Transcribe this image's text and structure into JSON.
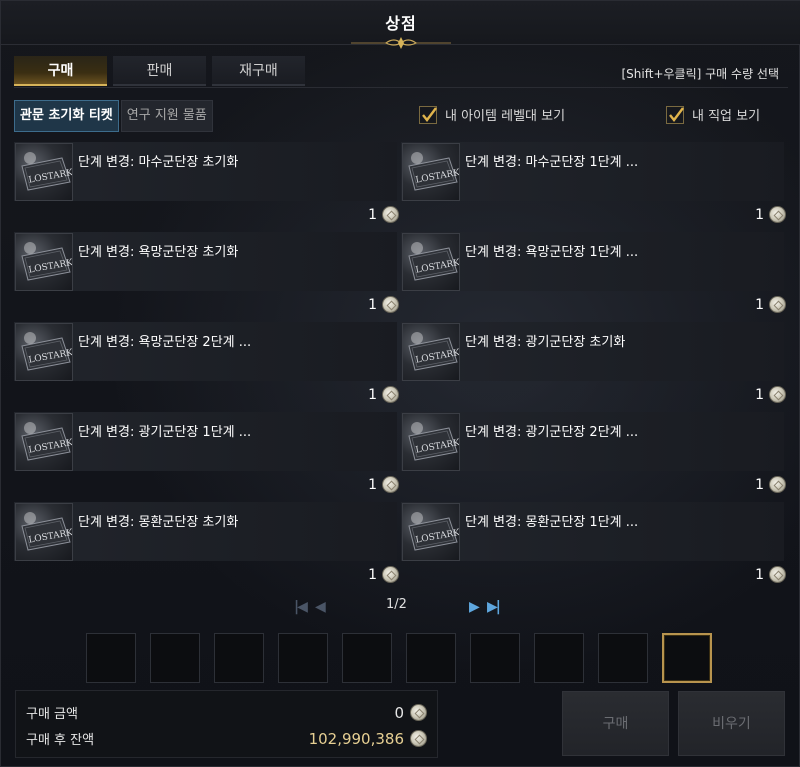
{
  "window": {
    "title": "상점"
  },
  "tabs": [
    {
      "label": "구매",
      "active": true
    },
    {
      "label": "판매",
      "active": false
    },
    {
      "label": "재구매",
      "active": false
    }
  ],
  "hint": "[Shift+우클릭] 구매 수량 선택",
  "subtabs": [
    {
      "label": "관문 초기화 티켓",
      "active": true
    },
    {
      "label": "연구 지원 물품",
      "active": false
    }
  ],
  "filters": [
    {
      "label": "내 아이템 레벨대 보기",
      "checked": true
    },
    {
      "label": "내 직업 보기",
      "checked": true
    }
  ],
  "items": [
    {
      "name": "단계 변경: 마수군단장 초기화",
      "price": "1"
    },
    {
      "name": "단계 변경: 마수군단장 1단계 ...",
      "price": "1"
    },
    {
      "name": "단계 변경: 욕망군단장 초기화",
      "price": "1"
    },
    {
      "name": "단계 변경: 욕망군단장 1단계 ...",
      "price": "1"
    },
    {
      "name": "단계 변경: 욕망군단장 2단계 ...",
      "price": "1"
    },
    {
      "name": "단계 변경: 광기군단장 초기화",
      "price": "1"
    },
    {
      "name": "단계 변경: 광기군단장 1단계 ...",
      "price": "1"
    },
    {
      "name": "단계 변경: 광기군단장 2단계 ...",
      "price": "1"
    },
    {
      "name": "단계 변경: 몽환군단장 초기화",
      "price": "1"
    },
    {
      "name": "단계 변경: 몽환군단장 1단계 ...",
      "price": "1"
    }
  ],
  "item_icon": {
    "brand": "LOSTARK",
    "icon_name": "lost-ark-ticket-icon"
  },
  "pager": {
    "text": "1/2",
    "current": 1,
    "total": 2
  },
  "cart_slots": 10,
  "summary": {
    "purchase_label": "구매 금액",
    "purchase_value": "0",
    "balance_label": "구매 후 잔액",
    "balance_value": "102,990,386"
  },
  "buttons": {
    "buy": "구매",
    "clear": "비우기"
  },
  "colors": {
    "accent_gold": "#d7b45a",
    "selected_blue": "#3d6c8c",
    "balance_gold": "#e6cf93"
  }
}
